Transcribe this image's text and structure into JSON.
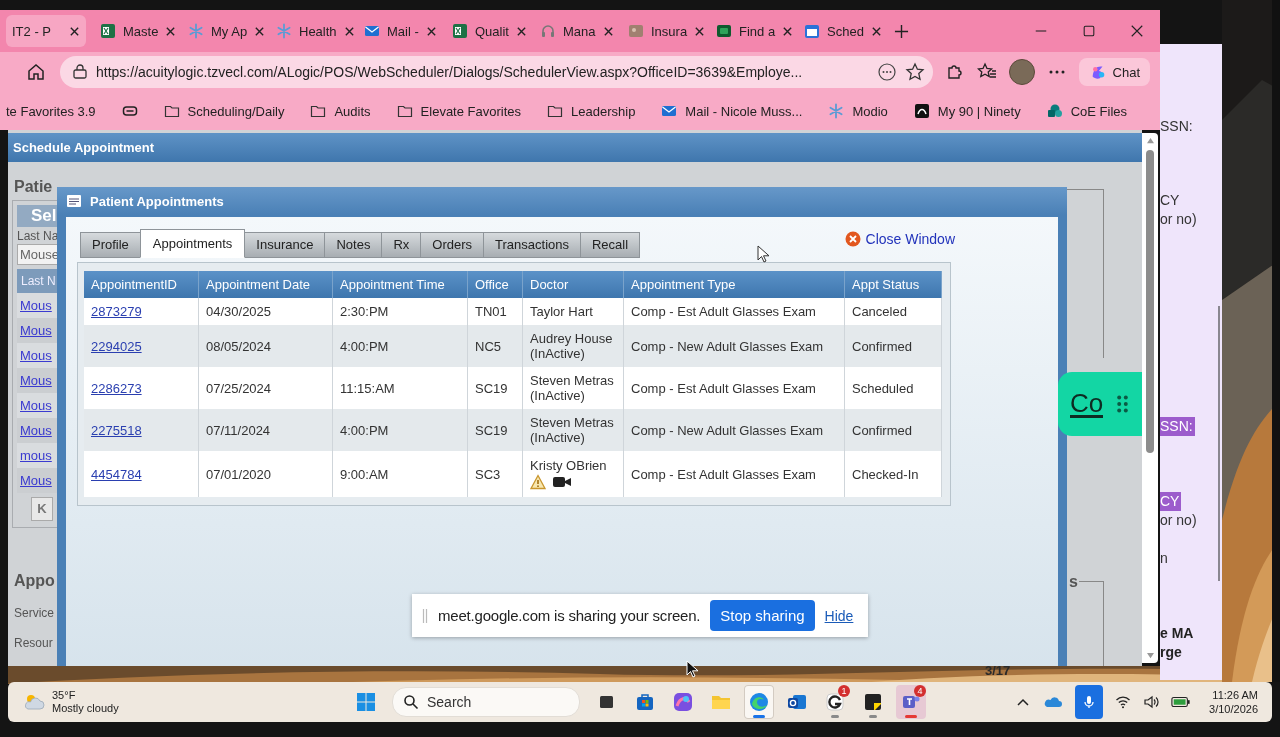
{
  "browser": {
    "tabs": [
      {
        "title": "IT2 - P",
        "kind": "none",
        "selected": true
      },
      {
        "title": "Maste",
        "kind": "sheet",
        "selected": false
      },
      {
        "title": "My Ap",
        "kind": "snowflake",
        "selected": false
      },
      {
        "title": "Health",
        "kind": "snowflake",
        "selected": false
      },
      {
        "title": "Mail -",
        "kind": "mail",
        "selected": false
      },
      {
        "title": "Qualit",
        "kind": "sheet",
        "selected": false
      },
      {
        "title": "Mana",
        "kind": "headset",
        "selected": false
      },
      {
        "title": "Insura",
        "selected": false
      },
      {
        "title": "Find a",
        "kind": "card",
        "selected": false
      },
      {
        "title": "Sched",
        "kind": "calendar",
        "selected": false
      }
    ],
    "url": "https://acuitylogic.tzvecl.com/ALogic/POS/WebScheduler/Dialogs/SchedulerView.aspx?OfficeID=3639&Employe...",
    "chat_label": "Chat",
    "bookmarks": [
      {
        "label": "te Favorites 3.9",
        "kind": "none"
      },
      {
        "kind": "collection"
      },
      {
        "label": "Scheduling/Daily",
        "kind": "folder"
      },
      {
        "label": "Audits",
        "kind": "folder"
      },
      {
        "label": "Elevate Favorites",
        "kind": "folder"
      },
      {
        "label": "Leadership",
        "kind": "folder"
      },
      {
        "label": "Mail - Nicole Muss...",
        "kind": "mail"
      },
      {
        "label": "Modio",
        "kind": "snowflake"
      },
      {
        "label": "My 90 | Ninety",
        "kind": "ninety"
      },
      {
        "label": "CoE Files",
        "kind": "circles"
      }
    ]
  },
  "page": {
    "title": "Schedule Appointment",
    "left": {
      "heading": "Patie",
      "subheader": "Sel",
      "field_label": "Last Na",
      "field_value": "Mouse",
      "column_header": "Last N",
      "links": [
        "Mous",
        "Mous",
        "Mous",
        "Mous",
        "Mous",
        "Mous",
        "mous",
        "Mous"
      ],
      "pager_button": "K",
      "heading_2": "Appo",
      "labels": [
        "Service",
        "Resour"
      ]
    },
    "right_heading": "s"
  },
  "dialog": {
    "title": "Patient Appointments",
    "tabs": [
      {
        "label": "Profile",
        "selected": false
      },
      {
        "label": "Appointments",
        "selected": true
      },
      {
        "label": "Insurance",
        "selected": false
      },
      {
        "label": "Notes",
        "selected": false
      },
      {
        "label": "Rx",
        "selected": false
      },
      {
        "label": "Orders",
        "selected": false
      },
      {
        "label": "Transactions",
        "selected": false
      },
      {
        "label": "Recall",
        "selected": false
      }
    ],
    "close_label": "Close Window",
    "table": {
      "columns": [
        "AppointmentID",
        "Appointment Date",
        "Appointment Time",
        "Office",
        "Doctor",
        "Appointment Type",
        "Appt Status"
      ],
      "rows": [
        {
          "kind": "plain",
          "id": "2873279",
          "date": "04/30/2025",
          "time": "2:30:PM",
          "office": "TN01",
          "doctor": "Taylor Hart",
          "type": "Comp - Est Adult Glasses Exam",
          "status": "Canceled"
        },
        {
          "kind": "plain",
          "id": "2294025",
          "date": "08/05/2024",
          "time": "4:00:PM",
          "office": "NC5",
          "doctor": "Audrey House (InActive)",
          "type": "Comp - New Adult Glasses Exam",
          "status": "Confirmed"
        },
        {
          "kind": "plain",
          "id": "2286273",
          "date": "07/25/2024",
          "time": "11:15:AM",
          "office": "SC19",
          "doctor": "Steven Metras (InActive)",
          "type": "Comp - Est Adult Glasses Exam",
          "status": "Scheduled"
        },
        {
          "kind": "plain",
          "id": "2275518",
          "date": "07/11/2024",
          "time": "4:00:PM",
          "office": "SC19",
          "doctor": "Steven Metras (InActive)",
          "type": "Comp - New Adult Glasses Exam",
          "status": "Confirmed"
        },
        {
          "kind": "flagged",
          "id": "4454784",
          "date": "07/01/2020",
          "time": "9:00:AM",
          "office": "SC3",
          "doctor": "Kristy OBrien",
          "type": "Comp - Est Adult Glasses Exam",
          "status": "Checked-In"
        }
      ]
    }
  },
  "widget": {
    "logo": "Co"
  },
  "share_bar": {
    "message": "meet.google.com is sharing your screen.",
    "stop_label": "Stop sharing",
    "hide_label": "Hide"
  },
  "side_panel": {
    "lines": [
      {
        "text": "SSN:",
        "highlighted": false,
        "bold": false
      },
      {
        "text": "CY",
        "highlighted": false,
        "bold": false
      },
      {
        "text": "or no)",
        "highlighted": false,
        "bold": false
      },
      {
        "text": "SSN:",
        "highlighted": true,
        "bold": false
      },
      {
        "text": "CY",
        "highlighted": true,
        "bold": false
      },
      {
        "text": "or no)",
        "highlighted": false,
        "bold": false
      },
      {
        "text": "n",
        "highlighted": false,
        "bold": false
      },
      {
        "text": "e MA",
        "highlighted": false,
        "bold": true
      },
      {
        "text": "rge",
        "highlighted": false,
        "bold": true
      }
    ]
  },
  "desktop_text": "3/17",
  "taskbar": {
    "weather": {
      "temperature": "35°F",
      "condition": "Mostly cloudy"
    },
    "search": {
      "placeholder": "Search"
    },
    "apps": [
      {
        "kind": "taskview",
        "open": false,
        "selected": false,
        "alert": false
      },
      {
        "kind": "store",
        "open": false,
        "selected": false,
        "alert": false
      },
      {
        "kind": "copilot",
        "open": false,
        "selected": false,
        "alert": false
      },
      {
        "kind": "folder",
        "open": false,
        "selected": false,
        "alert": false
      },
      {
        "kind": "edge",
        "open": true,
        "selected": true,
        "alert": false
      },
      {
        "kind": "outlook",
        "open": false,
        "selected": false,
        "alert": false
      },
      {
        "kind": "g-app",
        "open": true,
        "selected": false,
        "alert": false,
        "badge": "1"
      },
      {
        "kind": "notes",
        "open": true,
        "selected": false,
        "alert": false
      },
      {
        "kind": "teams",
        "open": true,
        "selected": false,
        "alert": true,
        "badge": "4"
      }
    ],
    "time": "11:26 AM",
    "date": "3/10/2026"
  }
}
